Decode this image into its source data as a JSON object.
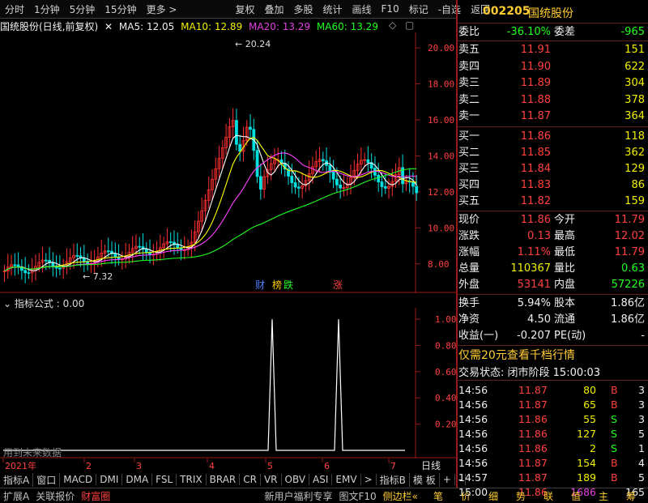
{
  "toolbar": {
    "items": [
      "分时",
      "1分钟",
      "5分钟",
      "15分钟",
      "更多 >",
      "复权",
      "叠加",
      "多股",
      "统计",
      "画线",
      "F10",
      "标记",
      "-自选",
      "返回"
    ]
  },
  "header": {
    "code": "002205",
    "name": "国统股份"
  },
  "legend": {
    "title": "国统股份(日线,前复权)",
    "ma5": "MA5: 12.05",
    "ma10": "MA10: 12.89",
    "ma20": "MA20: 13.29",
    "ma60": "MA60: 13.29"
  },
  "chart_data": [
    {
      "type": "line",
      "title": "国统股份(日线,前复权)",
      "y_ticks": [
        "20.00",
        "18.00",
        "16.00",
        "14.00",
        "12.00",
        "10.00",
        "8.00"
      ],
      "ylim": [
        7,
        20.5
      ],
      "x_ticks": [
        "2021年",
        "2",
        "3",
        "4",
        "5",
        "6",
        "7"
      ],
      "annotations": {
        "high": "20.24",
        "low": "7.32"
      },
      "markers": [
        {
          "text": "财",
          "color": "#5080ff"
        },
        {
          "text": "榜",
          "color": "#ffcc00"
        },
        {
          "text": "跌",
          "color": "#20ff20"
        },
        {
          "text": "涨",
          "color": "#ff4040"
        }
      ],
      "series": [
        {
          "name": "MA5",
          "color": "#ffffff"
        },
        {
          "name": "MA10",
          "color": "#ffff00"
        },
        {
          "name": "MA20",
          "color": "#ff40ff"
        },
        {
          "name": "MA60",
          "color": "#20ff20"
        }
      ]
    },
    {
      "type": "line",
      "title": "指标公式 : 0.00",
      "y_ticks": [
        "1.00",
        "0.80",
        "0.60",
        "0.40",
        "0.20"
      ],
      "ylim": [
        0,
        1.05
      ],
      "spikes_at_month": [
        "5",
        "6"
      ],
      "note": "用到未来数据"
    }
  ],
  "weibi": {
    "label1": "委比",
    "val1": "-36.10%",
    "label2": "委差",
    "val2": "-965"
  },
  "asks": [
    {
      "label": "卖五",
      "price": "11.91",
      "vol": "151"
    },
    {
      "label": "卖四",
      "price": "11.90",
      "vol": "622"
    },
    {
      "label": "卖三",
      "price": "11.89",
      "vol": "304"
    },
    {
      "label": "卖二",
      "price": "11.88",
      "vol": "378"
    },
    {
      "label": "卖一",
      "price": "11.87",
      "vol": "364"
    }
  ],
  "bids": [
    {
      "label": "买一",
      "price": "11.86",
      "vol": "118"
    },
    {
      "label": "买二",
      "price": "11.85",
      "vol": "362"
    },
    {
      "label": "买三",
      "price": "11.84",
      "vol": "129"
    },
    {
      "label": "买四",
      "price": "11.83",
      "vol": "86"
    },
    {
      "label": "买五",
      "price": "11.82",
      "vol": "159"
    }
  ],
  "quote": [
    {
      "l1": "现价",
      "v1": "11.86",
      "l2": "今开",
      "v2": "11.79",
      "c1": "red",
      "c2": "red"
    },
    {
      "l1": "涨跌",
      "v1": "0.13",
      "l2": "最高",
      "v2": "12.02",
      "c1": "red",
      "c2": "red"
    },
    {
      "l1": "涨幅",
      "v1": "1.11%",
      "l2": "最低",
      "v2": "11.79",
      "c1": "red",
      "c2": "red"
    },
    {
      "l1": "总量",
      "v1": "110367",
      "l2": "量比",
      "v2": "0.63",
      "c1": "yellow",
      "c2": "green"
    },
    {
      "l1": "外盘",
      "v1": "53141",
      "l2": "内盘",
      "v2": "57226",
      "c1": "red",
      "c2": "green"
    }
  ],
  "fin": [
    {
      "l1": "换手",
      "v1": "5.94%",
      "l2": "股本",
      "v2": "1.86亿"
    },
    {
      "l1": "净资",
      "v1": "4.50",
      "l2": "流通",
      "v2": "1.86亿"
    },
    {
      "l1": "收益(一)",
      "v1": "-0.207",
      "l2": "PE(动)",
      "v2": "-"
    }
  ],
  "promo": "仅需20元查看千档行情",
  "trade_status": {
    "label": "交易状态: 闭市阶段",
    "time": "15:00:03"
  },
  "ticks": [
    {
      "t": "14:56",
      "p": "11.87",
      "v": "80",
      "s": "B",
      "n": "3"
    },
    {
      "t": "14:56",
      "p": "11.87",
      "v": "65",
      "s": "B",
      "n": "3"
    },
    {
      "t": "14:56",
      "p": "11.86",
      "v": "55",
      "s": "S",
      "n": "3"
    },
    {
      "t": "14:56",
      "p": "11.86",
      "v": "127",
      "s": "S",
      "n": "5"
    },
    {
      "t": "14:56",
      "p": "11.86",
      "v": "2",
      "s": "S",
      "n": "1"
    },
    {
      "t": "14:56",
      "p": "11.87",
      "v": "154",
      "s": "B",
      "n": "4"
    },
    {
      "t": "14:57",
      "p": "11.87",
      "v": "189",
      "s": "B",
      "n": "5"
    },
    {
      "t": "15:00",
      "p": "11.86",
      "v": "1686",
      "s": "",
      "n": "165"
    }
  ],
  "bottom_tabs": [
    "指标A",
    "窗口",
    "MACD",
    "DMI",
    "DMA",
    "FSL",
    "TRIX",
    "BRAR",
    "CR",
    "VR",
    "OBV",
    "ASI",
    "EMV",
    ">",
    "指标B",
    "模 板",
    "+",
    "-"
  ],
  "period": "日线",
  "status": {
    "items": [
      "扩展A",
      "关联报价",
      "财富圈"
    ],
    "promo": "新用户福利专享",
    "f10": "图文F10",
    "side": "侧边栏«"
  },
  "right_tabs": [
    "笔",
    "价",
    "细",
    "势",
    "联",
    "值",
    "主",
    "筹"
  ]
}
